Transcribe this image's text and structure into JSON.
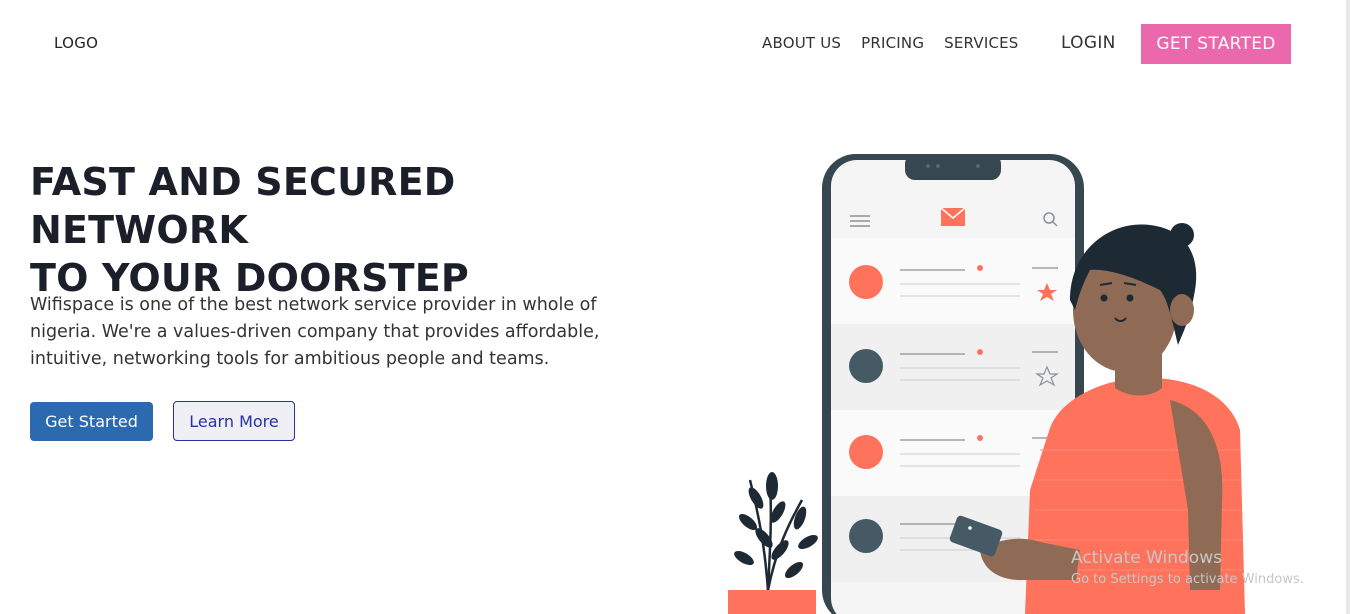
{
  "header": {
    "logo": "LOGO",
    "nav": [
      "ABOUT US",
      "PRICING",
      "SERVICES"
    ],
    "login": "LOGIN",
    "cta": "GET STARTED"
  },
  "hero": {
    "title_line1": "FAST AND SECURED NETWORK",
    "title_line2": "TO YOUR DOORSTEP",
    "text": "Wifispace is one of the best network service provider in whole of nigeria. We're a values-driven company that provides affordable, intuitive, networking tools for ambitious people and teams.",
    "btn_primary": "Get Started",
    "btn_secondary": "Learn More"
  },
  "colors": {
    "accent_pink": "#ec68ad",
    "primary_blue": "#2c6aaf",
    "coral": "#ff735c"
  },
  "watermark": {
    "line1": "Activate Windows",
    "line2": "Go to Settings to activate Windows."
  }
}
